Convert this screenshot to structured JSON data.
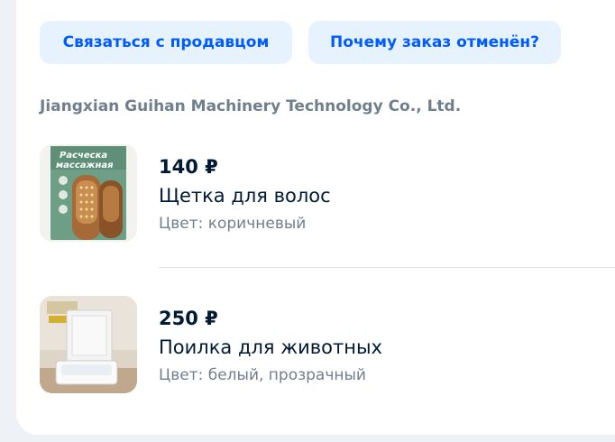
{
  "actions": {
    "contact_seller": "Связаться с продавцом",
    "why_cancelled": "Почему заказ отменён?"
  },
  "seller": {
    "name": "Jiangxian Guihan Machinery Technology Co., Ltd."
  },
  "items": [
    {
      "price": "140 ₽",
      "name": "Щетка для волос",
      "color": "Цвет: коричневый",
      "image_text_1": "Расческа",
      "image_text_2": "массажная"
    },
    {
      "price": "250 ₽",
      "name": "Поилка для животных",
      "color": "Цвет: белый, прозрачный"
    }
  ],
  "colors": {
    "accent": "#005bff",
    "button_bg": "#e6f3ff",
    "text_primary": "#001a34",
    "text_secondary": "#707f8d",
    "page_bg": "#eef2f7"
  }
}
